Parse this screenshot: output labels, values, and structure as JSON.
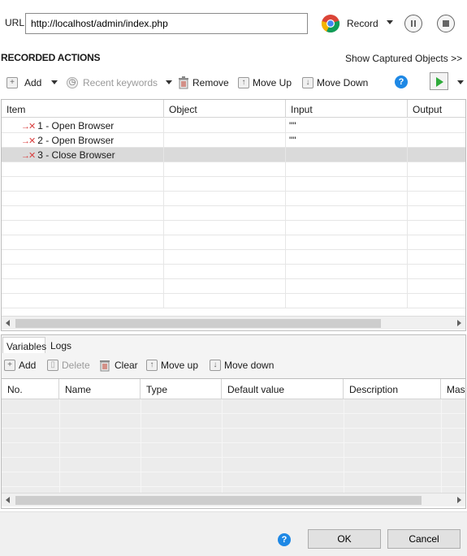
{
  "url_bar": {
    "label": "URL",
    "value": "http://localhost/admin/index.php"
  },
  "record": {
    "label": "Record"
  },
  "section": {
    "title": "RECORDED ACTIONS",
    "show_captured": "Show Captured Objects >>"
  },
  "toolbar": {
    "add": "Add",
    "recent_keywords": "Recent keywords",
    "remove": "Remove",
    "move_up": "Move Up",
    "move_down": "Move Down"
  },
  "actions_grid": {
    "columns": [
      "Item",
      "Object",
      "Input",
      "Output"
    ],
    "rows": [
      {
        "item": "1 - Open Browser",
        "object": "",
        "input": "\"\"",
        "output": ""
      },
      {
        "item": "2 - Open Browser",
        "object": "",
        "input": "\"\"",
        "output": ""
      },
      {
        "item": "3 - Close Browser",
        "object": "",
        "input": "",
        "output": ""
      }
    ]
  },
  "bottom_tabs": [
    "Variables",
    "Logs"
  ],
  "var_toolbar": {
    "add": "Add",
    "delete": "Delete",
    "clear": "Clear",
    "move_up": "Move up",
    "move_down": "Move down"
  },
  "var_grid": {
    "columns": [
      "No.",
      "Name",
      "Type",
      "Default value",
      "Description",
      "Mas"
    ]
  },
  "footer": {
    "ok": "OK",
    "cancel": "Cancel"
  },
  "colors": {
    "help_blue": "#1e88e5",
    "run_green": "#2eaa3a",
    "failed_red": "#d94040"
  },
  "icons": [
    "chrome-icon",
    "pause-icon",
    "stop-icon",
    "add-icon",
    "clock-icon",
    "trash-icon",
    "arrow-up-icon",
    "arrow-down-icon",
    "help-icon",
    "play-icon",
    "failed-step-icon"
  ]
}
